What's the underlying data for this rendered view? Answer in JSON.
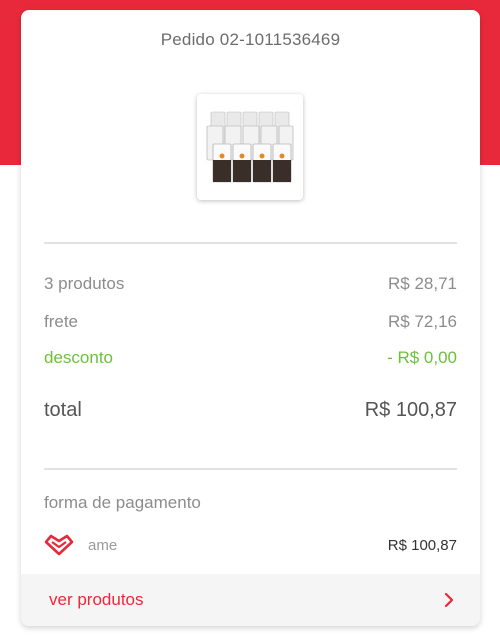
{
  "order": {
    "title": "Pedido 02-1011536469"
  },
  "summary": {
    "products_label": "3 produtos",
    "products_value": "R$ 28,71",
    "shipping_label": "frete",
    "shipping_value": "R$ 72,16",
    "discount_label": "desconto",
    "discount_value": "- R$ 0,00",
    "total_label": "total",
    "total_value": "R$ 100,87"
  },
  "payment": {
    "section_label": "forma de pagamento",
    "method": "ame",
    "amount": "R$ 100,87",
    "icon": "heart-icon"
  },
  "footer": {
    "view_products_label": "ver produtos",
    "icon": "chevron-right-icon"
  },
  "colors": {
    "brand": "#e8293b",
    "discount": "#6cc13c"
  }
}
